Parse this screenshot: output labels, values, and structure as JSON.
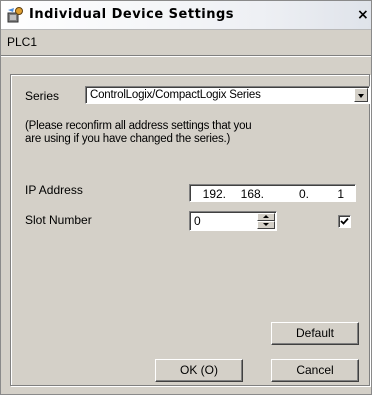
{
  "window": {
    "title": "Individual Device Settings",
    "close_glyph": "×"
  },
  "device": {
    "name": "PLC1"
  },
  "series": {
    "label": "Series",
    "value": "ControlLogix/CompactLogix Series",
    "note_line1": "(Please reconfirm all address settings that you",
    "note_line2": "are using if you have changed the series.)"
  },
  "ip": {
    "label": "IP Address",
    "octets": [
      "192.",
      "168.",
      "0.",
      "1"
    ]
  },
  "slot": {
    "label": "Slot Number",
    "value": "0",
    "checked": true
  },
  "buttons": {
    "default": "Default",
    "ok": "OK (O)",
    "cancel": "Cancel"
  },
  "icons": {
    "title": "device-settings-icon",
    "dropdown": "chevron-down-icon",
    "spin": "spinner-arrows-icon",
    "check": "check-icon"
  }
}
